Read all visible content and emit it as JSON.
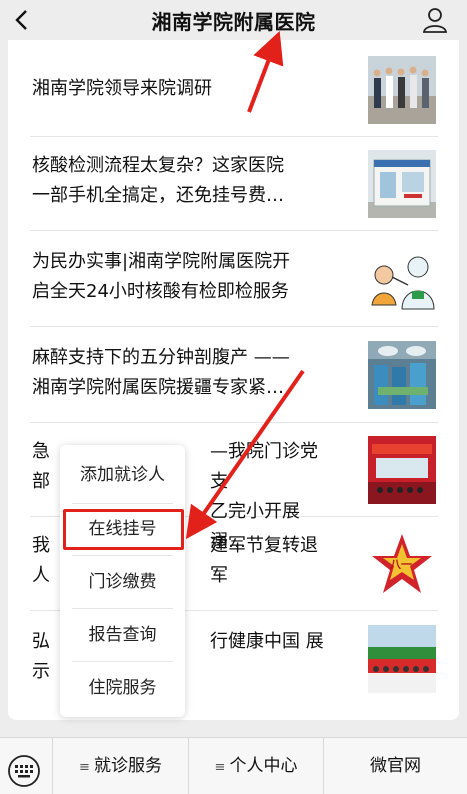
{
  "header": {
    "title": "湘南学院附属医院"
  },
  "articles": [
    {
      "lines": [
        "湘南学院领导来院调研"
      ]
    },
    {
      "lines": [
        "核酸检测流程太复杂？这家医院",
        "一部手机全搞定，还免挂号费…"
      ]
    },
    {
      "lines": [
        "为民办实事|湘南学院附属医院开",
        "启全天24小时核酸有检即检服务"
      ]
    },
    {
      "lines": [
        "麻醉支持下的五分钟剖腹产 ——",
        "湘南学院附属医院援疆专家紧…"
      ]
    },
    {
      "lines": [
        "急",
        "部"
      ],
      "tail": [
        "—我院门诊党支",
        "乙完小开展溺…"
      ]
    },
    {
      "lines": [
        "我",
        "人"
      ],
      "tail": [
        "建军节复转退军",
        ""
      ]
    },
    {
      "lines": [
        "弘",
        "示"
      ],
      "tail": [
        "行健康中国  展",
        ""
      ]
    }
  ],
  "thumb_badge": "八一",
  "popup_menu": {
    "items": [
      "添加就诊人",
      "在线挂号",
      "门诊缴费",
      "报告查询",
      "住院服务"
    ]
  },
  "bottom_nav": {
    "tabs": [
      "就诊服务",
      "个人中心",
      "微官网"
    ]
  },
  "colors": {
    "highlight": "#e3211b",
    "background": "#ededed"
  }
}
